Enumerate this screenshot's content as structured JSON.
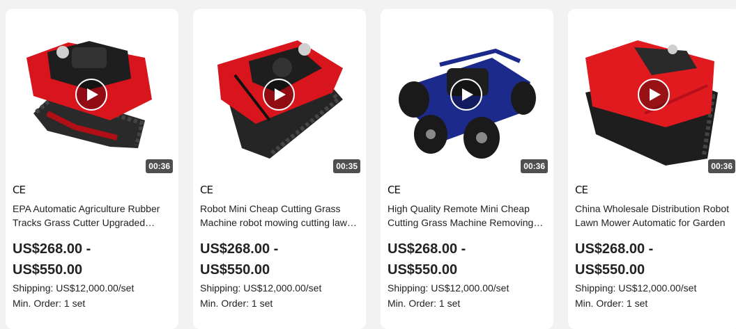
{
  "products": [
    {
      "cert": "CE",
      "title": "EPA Automatic Agriculture Rubber Tracks Grass Cutter Upgraded Remote Control Lawn Mower",
      "price_line1": "US$268.00 -",
      "price_line2": "US$550.00",
      "shipping": "Shipping: US$12,000.00/set",
      "min_order": "Min. Order: 1 set",
      "duration": "00:36",
      "body_color": "#d8141c"
    },
    {
      "cert": "CE",
      "title": "Robot Mini Cheap Cutting Grass Machine robot mowing cutting lawn mower",
      "price_line1": "US$268.00 -",
      "price_line2": "US$550.00",
      "shipping": "Shipping: US$12,000.00/set",
      "min_order": "Min. Order: 1 set",
      "duration": "00:35",
      "body_color": "#d8141c"
    },
    {
      "cert": "CE",
      "title": "High Quality Remote Mini Cheap Cutting Grass Machine Removing Lawn Mower",
      "price_line1": "US$268.00 -",
      "price_line2": "US$550.00",
      "shipping": "Shipping: US$12,000.00/set",
      "min_order": "Min. Order: 1 set",
      "duration": "00:36",
      "body_color": "#1c2a8c"
    },
    {
      "cert": "CE",
      "title": "China Wholesale Distribution Robot Lawn Mower Automatic for Garden",
      "price_line1": "US$268.00 -",
      "price_line2": "US$550.00",
      "shipping": "Shipping: US$12,000.00/set",
      "min_order": "Min. Order: 1 set",
      "duration": "00:36",
      "body_color": "#e01a1f"
    }
  ]
}
